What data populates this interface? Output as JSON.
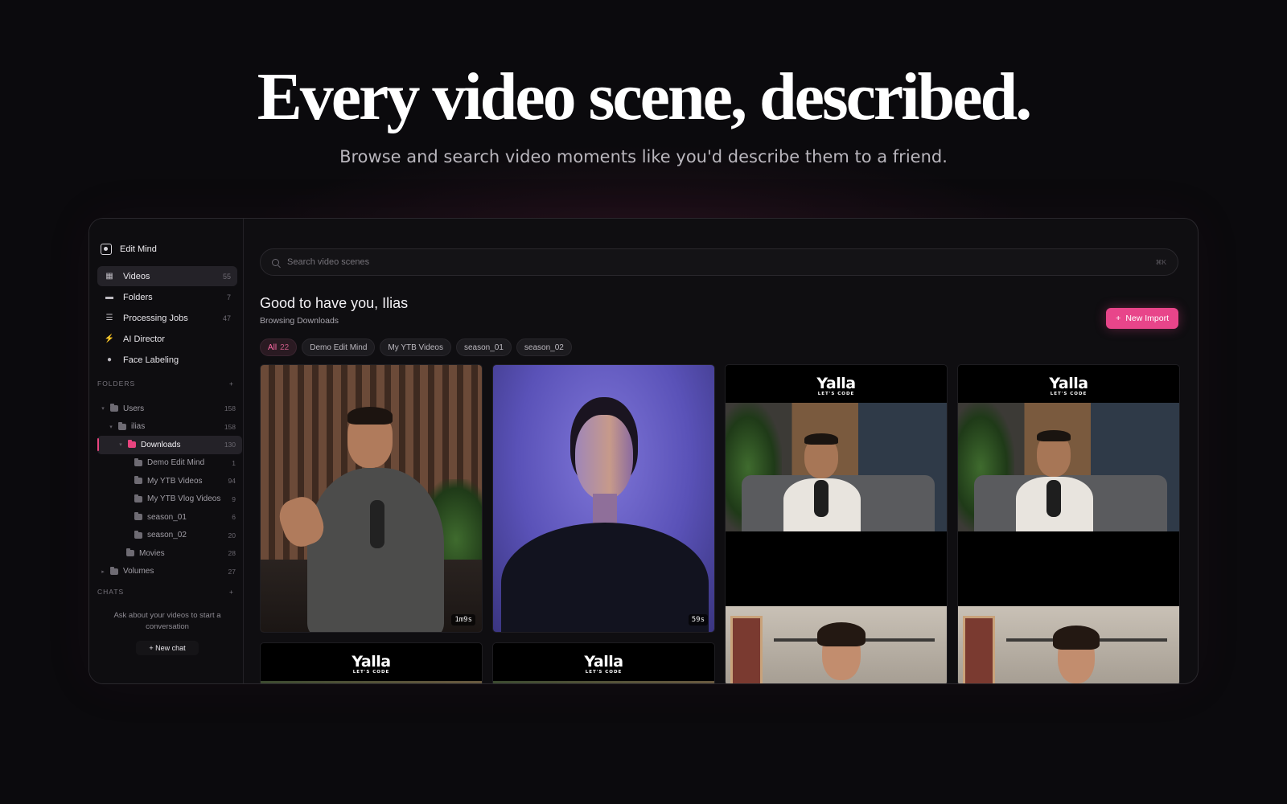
{
  "hero": {
    "title": "Every video scene, described.",
    "subtitle": "Browse and search video moments like you'd describe them to a friend."
  },
  "app": {
    "brand": {
      "name": "Edit Mind",
      "icon": "scan-icon"
    },
    "nav": [
      {
        "label": "Videos",
        "count": "55",
        "icon": "table-icon",
        "active": true
      },
      {
        "label": "Folders",
        "count": "7",
        "icon": "folder-icon"
      },
      {
        "label": "Processing Jobs",
        "count": "47",
        "icon": "list-icon"
      },
      {
        "label": "AI Director",
        "count": "",
        "icon": "bolt-icon"
      },
      {
        "label": "Face Labeling",
        "count": "",
        "icon": "users-icon"
      }
    ],
    "folders_section": {
      "label": "FOLDERS",
      "add": "+"
    },
    "tree": [
      {
        "label": "Users",
        "count": "158"
      },
      {
        "label": "ilias",
        "count": "158"
      },
      {
        "label": "Downloads",
        "count": "130"
      },
      {
        "label": "Demo Edit Mind",
        "count": "1"
      },
      {
        "label": "My YTB Videos",
        "count": "94"
      },
      {
        "label": "My YTB Vlog Videos",
        "count": "9"
      },
      {
        "label": "season_01",
        "count": "6"
      },
      {
        "label": "season_02",
        "count": "20"
      },
      {
        "label": "Movies",
        "count": "28"
      },
      {
        "label": "Volumes",
        "count": "27"
      }
    ],
    "chats_section": {
      "label": "CHATS",
      "add": "+"
    },
    "chat_empty": "Ask about your videos to start a conversation",
    "new_chat": "+ New chat",
    "search": {
      "placeholder": "Search video scenes",
      "shortcut": "⌘K"
    },
    "greeting": "Good to have you, Ilias",
    "browsing": "Browsing Downloads",
    "new_import": {
      "icon": "+",
      "label": "New Import"
    },
    "filters": [
      {
        "label": "All",
        "count": "22",
        "active": true
      },
      {
        "label": "Demo Edit Mind"
      },
      {
        "label": "My YTB Videos"
      },
      {
        "label": "season_01"
      },
      {
        "label": "season_02"
      }
    ],
    "cards": [
      {
        "duration": "1m9s"
      },
      {
        "duration": "59s"
      },
      {
        "logo": "Yalla",
        "logo_sub": "LET'S CODE"
      },
      {
        "logo": "Yalla",
        "logo_sub": "LET'S CODE"
      },
      {
        "logo": "Yalla",
        "logo_sub": "LET'S CODE"
      },
      {
        "logo": "Yalla",
        "logo_sub": "LET'S CODE"
      }
    ],
    "colors": {
      "accent": "#e8458a",
      "background": "#0b0a0d",
      "panel": "#0f0e11"
    }
  }
}
